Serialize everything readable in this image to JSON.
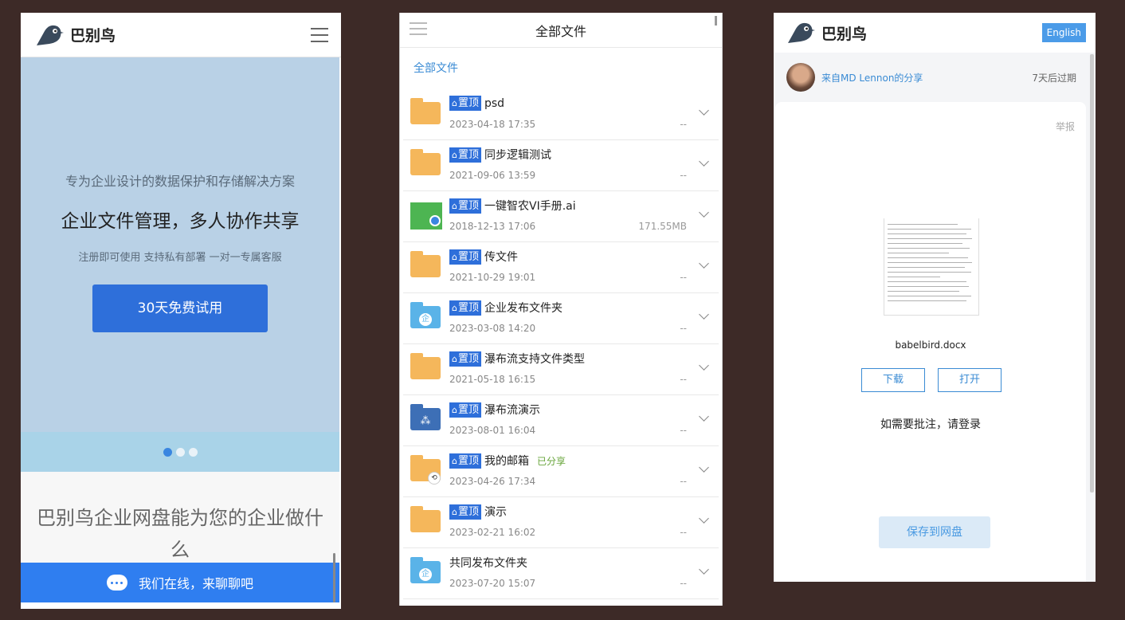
{
  "phone1": {
    "brand": "巴别鸟",
    "banner": {
      "subtitle": "专为企业设计的数据保护和存储解决方案",
      "title": "企业文件管理，多人协作共享",
      "features": "注册即可使用 支持私有部署 一对一专属客服",
      "cta": "30天免费试用"
    },
    "carousel": {
      "count": 3,
      "active": 0
    },
    "section_title": "巴别鸟企业网盘能为您的企业做什么",
    "chat": "我们在线，来聊聊吧"
  },
  "phone2": {
    "header_title": "全部文件",
    "breadcrumb": "全部文件",
    "pin_label": "置顶",
    "files": [
      {
        "name": "psd",
        "date": "2023-04-18 17:35",
        "size": "--",
        "icon": "folder-yellow",
        "pinned": true,
        "shared": ""
      },
      {
        "name": "同步逻辑测试",
        "date": "2021-09-06 13:59",
        "size": "--",
        "icon": "folder-yellow",
        "pinned": true,
        "shared": ""
      },
      {
        "name": "一键智农VI手册.ai",
        "date": "2018-12-13 17:06",
        "size": "171.55MB",
        "icon": "ai-file",
        "pinned": true,
        "shared": ""
      },
      {
        "name": "传文件",
        "date": "2021-10-29 19:01",
        "size": "--",
        "icon": "folder-yellow",
        "pinned": true,
        "shared": ""
      },
      {
        "name": "企业发布文件夹",
        "date": "2023-03-08 14:20",
        "size": "--",
        "icon": "folder-enterprise",
        "pinned": true,
        "shared": ""
      },
      {
        "name": "瀑布流支持文件类型",
        "date": "2021-05-18 16:15",
        "size": "--",
        "icon": "folder-yellow",
        "pinned": true,
        "shared": ""
      },
      {
        "name": "瀑布流演示",
        "date": "2023-08-01 16:04",
        "size": "--",
        "icon": "folder-dark",
        "pinned": true,
        "shared": ""
      },
      {
        "name": "我的邮箱",
        "date": "2023-04-26 17:34",
        "size": "--",
        "icon": "folder-shared",
        "pinned": true,
        "shared": "已分享"
      },
      {
        "name": "演示",
        "date": "2023-02-21 16:02",
        "size": "--",
        "icon": "folder-yellow",
        "pinned": true,
        "shared": ""
      },
      {
        "name": "共同发布文件夹",
        "date": "2023-07-20 15:07",
        "size": "--",
        "icon": "folder-enterprise",
        "pinned": false,
        "shared": ""
      }
    ]
  },
  "phone3": {
    "brand": "巴别鸟",
    "lang_button": "English",
    "share_from": "来自MD Lennon的分享",
    "expire": "7天后过期",
    "report": "举报",
    "doc_name": "babelbird.docx",
    "download": "下载",
    "open": "打开",
    "login_note": "如需要批注，请登录",
    "save": "保存到网盘"
  },
  "colors": {
    "primary": "#2e6fda",
    "link": "#3a8bd4",
    "folder": "#f5b75b",
    "background": "#3d2a27"
  }
}
